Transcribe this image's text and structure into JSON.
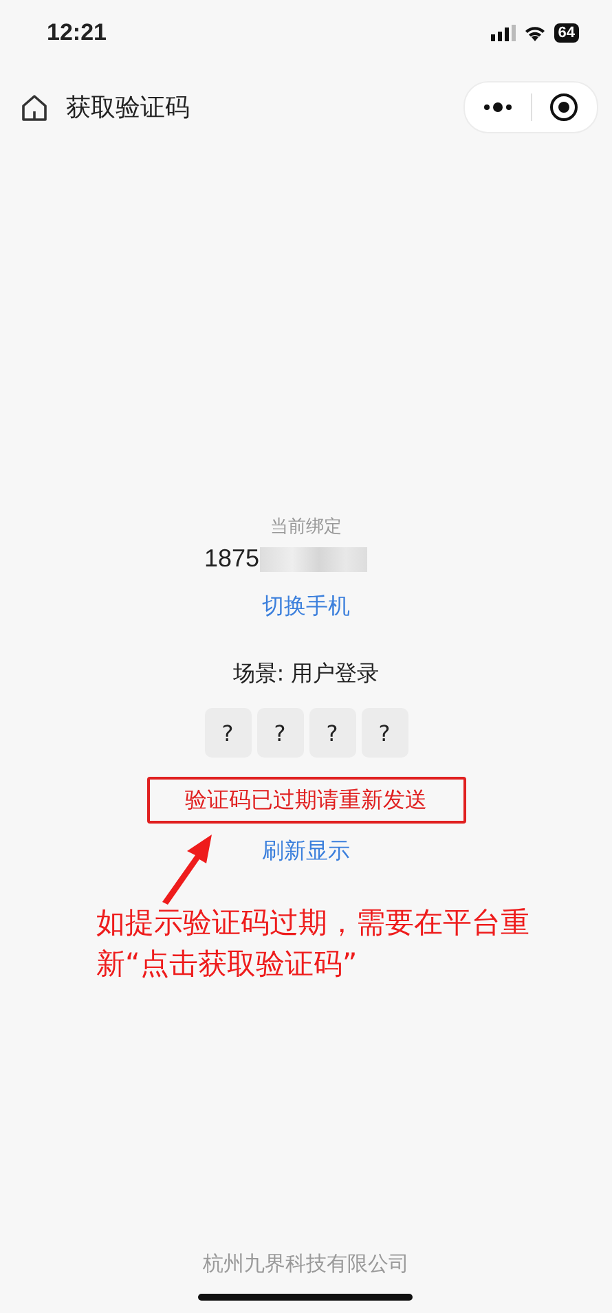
{
  "status_bar": {
    "time": "12:21",
    "battery": "64"
  },
  "nav_bar": {
    "title": "获取验证码"
  },
  "binding": {
    "label": "当前绑定",
    "phone": "1875",
    "switch_link": "切换手机"
  },
  "scene": {
    "label": "场景: 用户登录"
  },
  "code_boxes": [
    "?",
    "?",
    "?",
    "?"
  ],
  "error_message": "验证码已过期请重新发送",
  "refresh_link": "刷新显示",
  "annotation": {
    "text": "如提示验证码过期，需要在平台重新“点击获取验证码”"
  },
  "footer": "杭州九界科技有限公司"
}
